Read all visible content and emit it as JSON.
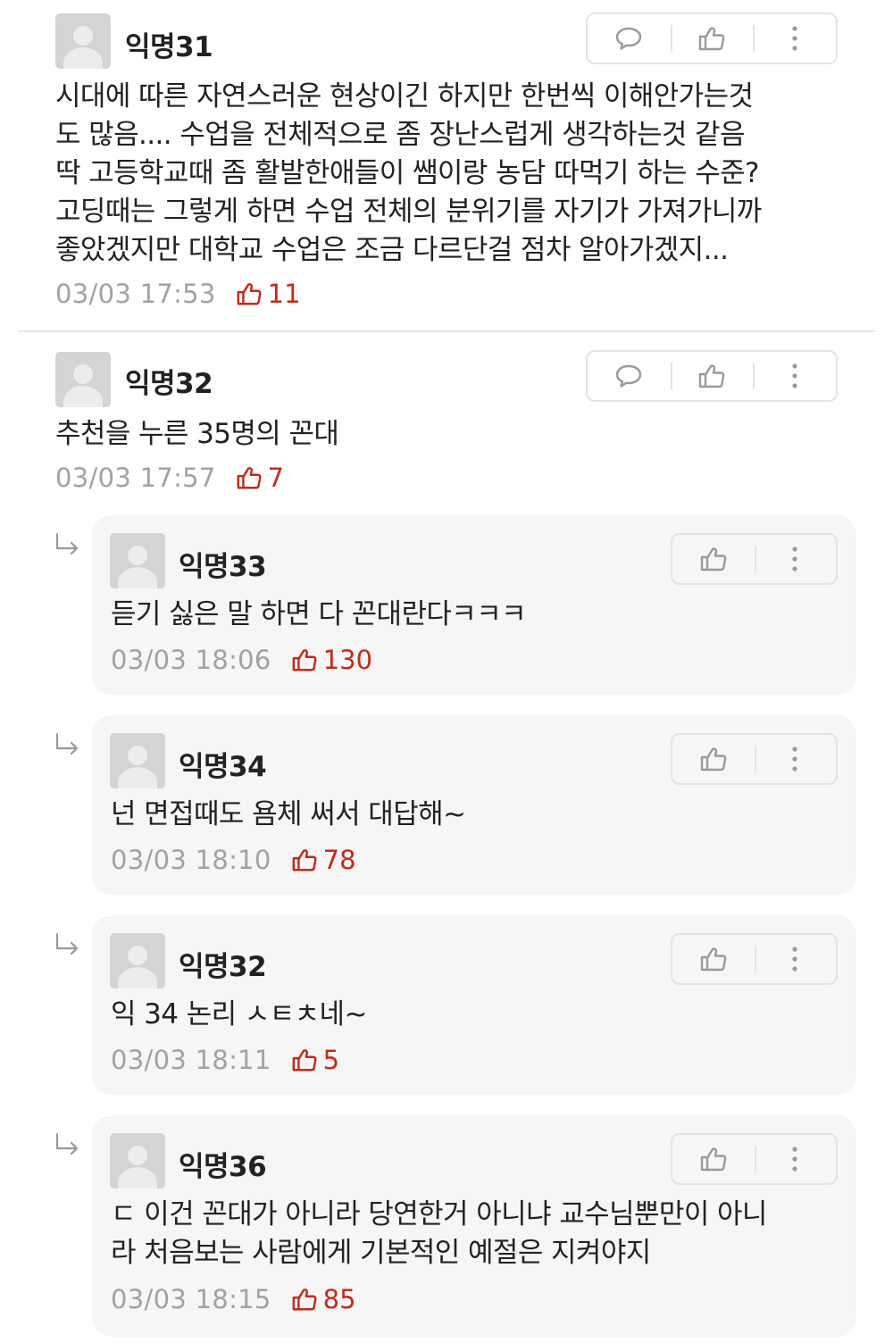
{
  "icons": {
    "comment": "speech-bubble-icon",
    "vote": "thumbs-up-icon",
    "more": "vertical-ellipsis-icon",
    "reply": "reply-arrow-icon"
  },
  "colors": {
    "like_count": "#c62917",
    "timestamp": "#a2a2a2",
    "reply_background": "#f6f6f6"
  },
  "comments": [
    {
      "author": "익명31",
      "text": "시대에 따른 자연스러운 현상이긴 하지만 한번씩 이해안가는것\n도 많음.... 수업을 전체적으로 좀 장난스럽게 생각하는것 같음\n딱 고등학교때 좀 활발한애들이 쌤이랑 농담 따먹기 하는 수준?\n고딩때는 그렇게 하면 수업 전체의 분위기를 자기가 가져가니까\n좋았겠지만 대학교 수업은 조금 다르단걸 점차 알아가겠지...",
      "time": "03/03 17:53",
      "likes": "11"
    },
    {
      "author": "익명32",
      "text": "추천을 누른 35명의 꼰대",
      "time": "03/03 17:57",
      "likes": "7"
    }
  ],
  "replies": [
    {
      "author": "익명33",
      "text": "듣기 싫은 말 하면 다 꼰대란다ㅋㅋㅋ",
      "time": "03/03 18:06",
      "likes": "130"
    },
    {
      "author": "익명34",
      "text": "넌 면접때도 욤체 써서 대답해~",
      "time": "03/03 18:10",
      "likes": "78"
    },
    {
      "author": "익명32",
      "text": "익 34 논리 ㅅㅌㅊ네~",
      "time": "03/03 18:11",
      "likes": "5"
    },
    {
      "author": "익명36",
      "text": "ㄷ 이건 꼰대가 아니라 당연한거 아니냐 교수님뿐만이 아니\n라 처음보는 사람에게 기본적인 예절은 지켜야지",
      "time": "03/03 18:15",
      "likes": "85"
    }
  ]
}
